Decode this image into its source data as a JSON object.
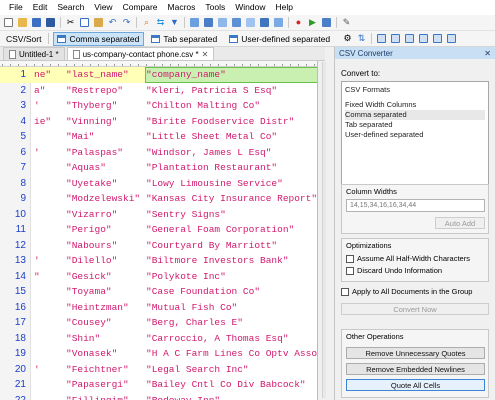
{
  "menu": [
    "File",
    "Edit",
    "Search",
    "View",
    "Compare",
    "Macros",
    "Tools",
    "Window",
    "Help"
  ],
  "toolbar2": {
    "csv_sort_label": "CSV/Sort",
    "modes": [
      {
        "label": "Comma separated",
        "active": true
      },
      {
        "label": "Tab separated",
        "active": false
      },
      {
        "label": "User-defined separated",
        "active": false
      }
    ]
  },
  "tabs": [
    {
      "label": "Untitled-1 *",
      "active": false
    },
    {
      "label": "us-company-contact phone.csv *",
      "active": true
    }
  ],
  "rows": [
    {
      "n": "1",
      "c0": "ne\"",
      "c1": "\"last_name\"",
      "c2": "\"company_name\""
    },
    {
      "n": "2",
      "c0": "a\"",
      "c1": "\"Restrepo\"",
      "c2": "\"Kleri, Patricia S Esq\""
    },
    {
      "n": "3",
      "c0": "'",
      "c1": "\"Thyberg\"",
      "c2": "\"Chilton Malting Co\""
    },
    {
      "n": "4",
      "c0": "ie\"",
      "c1": "\"Vinning\"",
      "c2": "\"Birite Foodservice Distr\""
    },
    {
      "n": "5",
      "c0": "",
      "c1": "\"Mai\"",
      "c2": "\"Little Sheet Metal Co\""
    },
    {
      "n": "6",
      "c0": "'",
      "c1": "\"Palaspas\"",
      "c2": "\"Windsor, James L Esq\""
    },
    {
      "n": "7",
      "c0": "",
      "c1": "\"Aquas\"",
      "c2": "\"Plantation Restaurant\""
    },
    {
      "n": "8",
      "c0": "",
      "c1": "\"Uyetake\"",
      "c2": "\"Lowy Limousine Service\""
    },
    {
      "n": "9",
      "c0": "",
      "c1": "\"Modzelewski\"",
      "c2": "\"Kansas City Insurance Report\""
    },
    {
      "n": "10",
      "c0": "",
      "c1": "\"Vizarro\"",
      "c2": "\"Sentry Signs\""
    },
    {
      "n": "11",
      "c0": "",
      "c1": "\"Perigo\"",
      "c2": "\"General Foam Corporation\""
    },
    {
      "n": "12",
      "c0": "",
      "c1": "\"Nabours\"",
      "c2": "\"Courtyard By Marriott\""
    },
    {
      "n": "13",
      "c0": "'",
      "c1": "\"Dilello\"",
      "c2": "\"Biltmore Investors Bank\""
    },
    {
      "n": "14",
      "c0": "\"",
      "c1": "\"Gesick\"",
      "c2": "\"Polykote Inc\""
    },
    {
      "n": "15",
      "c0": "",
      "c1": "\"Toyama\"",
      "c2": "\"Case Foundation Co\""
    },
    {
      "n": "16",
      "c0": "",
      "c1": "\"Heintzman\"",
      "c2": "\"Mutual Fish Co\""
    },
    {
      "n": "17",
      "c0": "",
      "c1": "\"Cousey\"",
      "c2": "\"Berg, Charles E\""
    },
    {
      "n": "18",
      "c0": "",
      "c1": "\"Shin\"",
      "c2": "\"Carroccio, A Thomas Esq\""
    },
    {
      "n": "19",
      "c0": "",
      "c1": "\"Vonasek\"",
      "c2": "\"H A C Farm Lines Co Optv Assoc\""
    },
    {
      "n": "20",
      "c0": "'",
      "c1": "\"Feichtner\"",
      "c2": "\"Legal Search Inc\""
    },
    {
      "n": "21",
      "c0": "",
      "c1": "\"Papasergi\"",
      "c2": "\"Bailey Cntl Co Div Babcock\""
    },
    {
      "n": "22",
      "c0": "",
      "c1": "\"Fillingim\"",
      "c2": "\"Rodeway Inn\""
    }
  ],
  "panel": {
    "title": "CSV Converter",
    "convert_to_label": "Convert to:",
    "formats_header": "CSV Formats",
    "formats": [
      "Fixed Width Columns",
      "Comma separated",
      "Tab separated",
      "User-defined separated"
    ],
    "selected_format_index": 1,
    "column_widths_label": "Column Widths",
    "column_widths_value": "14,15,34,16,16,34,44",
    "auto_add_label": "Auto Add",
    "optimizations_label": "Optimizations",
    "opt_half_width": "Assume All Half-Width Characters",
    "opt_discard_undo": "Discard Undo Information",
    "apply_all_label": "Apply to All Documents in the Group",
    "convert_now_label": "Convert Now",
    "other_ops_label": "Other Operations",
    "remove_quotes_label": "Remove Unnecessary Quotes",
    "remove_newlines_label": "Remove Embedded Newlines",
    "quote_all_label": "Quote All Cells"
  }
}
